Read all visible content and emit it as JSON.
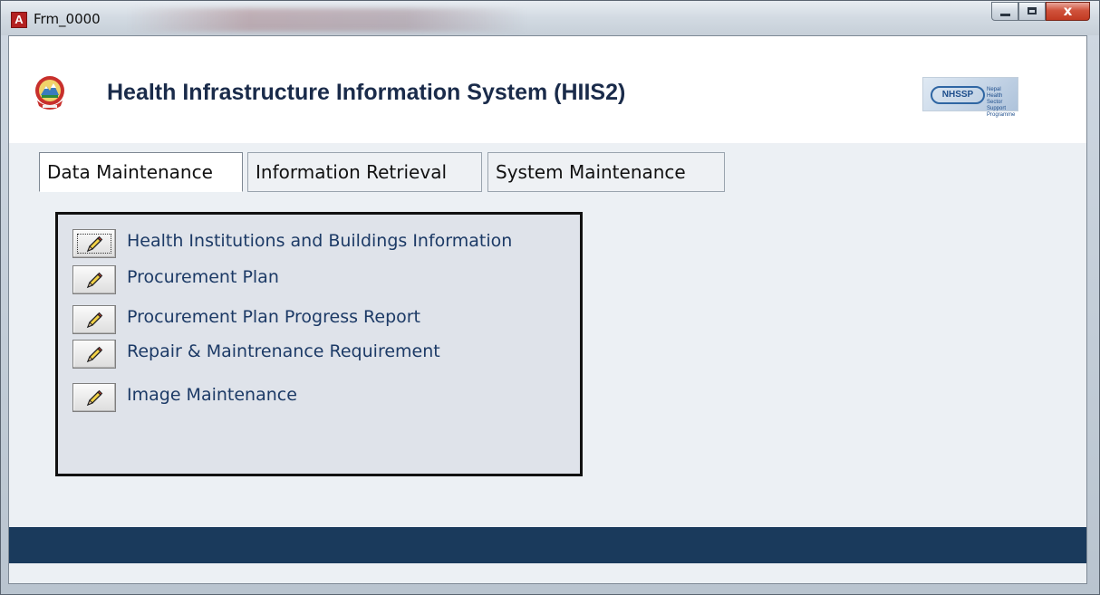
{
  "window": {
    "title": "Frm_0000",
    "app_icon_letter": "A",
    "controls": {
      "close": "x"
    }
  },
  "header": {
    "app_title": "Health Infrastructure Information System (HIIS2)",
    "logo_text": "NHSSP",
    "logo_subtext": "Nepal Health Sector Support Programme"
  },
  "tabs": [
    {
      "label": "Data Maintenance",
      "active": true
    },
    {
      "label": "Information Retrieval",
      "active": false
    },
    {
      "label": "System Maintenance",
      "active": false
    }
  ],
  "menu": {
    "items": [
      {
        "label": "Health Institutions and Buildings Information",
        "icon": "pencil-icon"
      },
      {
        "label": "Procurement Plan",
        "icon": "pencil-icon"
      },
      {
        "label": "Procurement Plan Progress Report",
        "icon": "pencil-icon"
      },
      {
        "label": "Repair & Maintrenance Requirement",
        "icon": "pencil-icon"
      },
      {
        "label": "Image Maintenance",
        "icon": "pencil-icon"
      }
    ]
  },
  "colors": {
    "title_text": "#1a2b4a",
    "menu_text": "#1c3a66",
    "footer_bar": "#1a3a5c",
    "close_button": "#c23a22"
  }
}
